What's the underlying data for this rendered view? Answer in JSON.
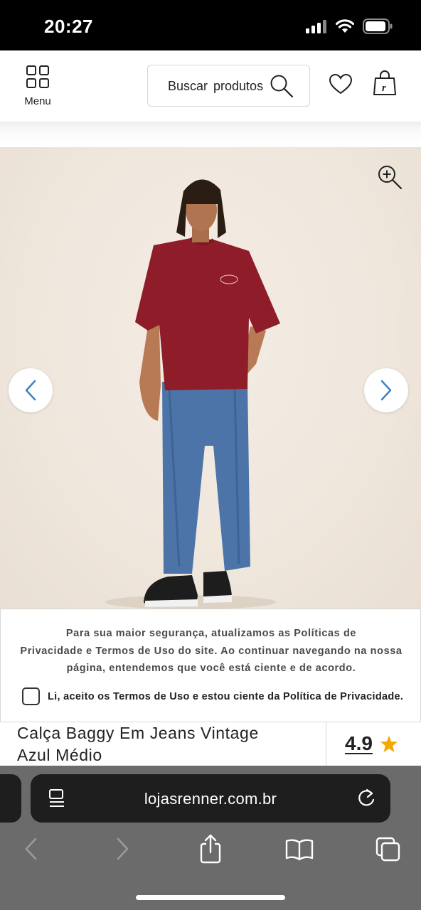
{
  "status_bar": {
    "time": "20:27",
    "icons": [
      "signal-icon",
      "wifi-icon",
      "battery-icon"
    ]
  },
  "header": {
    "menu_label": "Menu",
    "search_placeholder": "Buscar produtos",
    "icons": [
      "grid-menu-icon",
      "search-icon",
      "heart-icon",
      "shopping-bag-icon"
    ]
  },
  "gallery": {
    "icons": [
      "zoom-in-icon",
      "chevron-left-icon",
      "chevron-right-icon"
    ],
    "colors": {
      "arrow": "#3b82c4",
      "background": "#efe6dc"
    }
  },
  "privacy_banner": {
    "line1": "Para sua maior segurança, atualizamos as Políticas de",
    "line2": "Privacidade e Termos de Uso do site. Ao continuar navegando na nossa",
    "line3": "página, entendemos que você está ciente e de acordo.",
    "checkbox_label": "Li, aceito os Termos de Uso e estou ciente da Política de Privacidade.",
    "checkbox_checked": false
  },
  "product": {
    "title_line1": "Calça Baggy Em Jeans Vintage",
    "title_line2": "Azul Médio",
    "rating": "4.9",
    "rating_color": "#f2a900"
  },
  "browser": {
    "url": "lojasrenner.com.br",
    "icons": [
      "reader-icon",
      "reload-icon",
      "back-icon",
      "forward-icon",
      "share-icon",
      "bookmarks-icon",
      "tabs-icon"
    ]
  }
}
